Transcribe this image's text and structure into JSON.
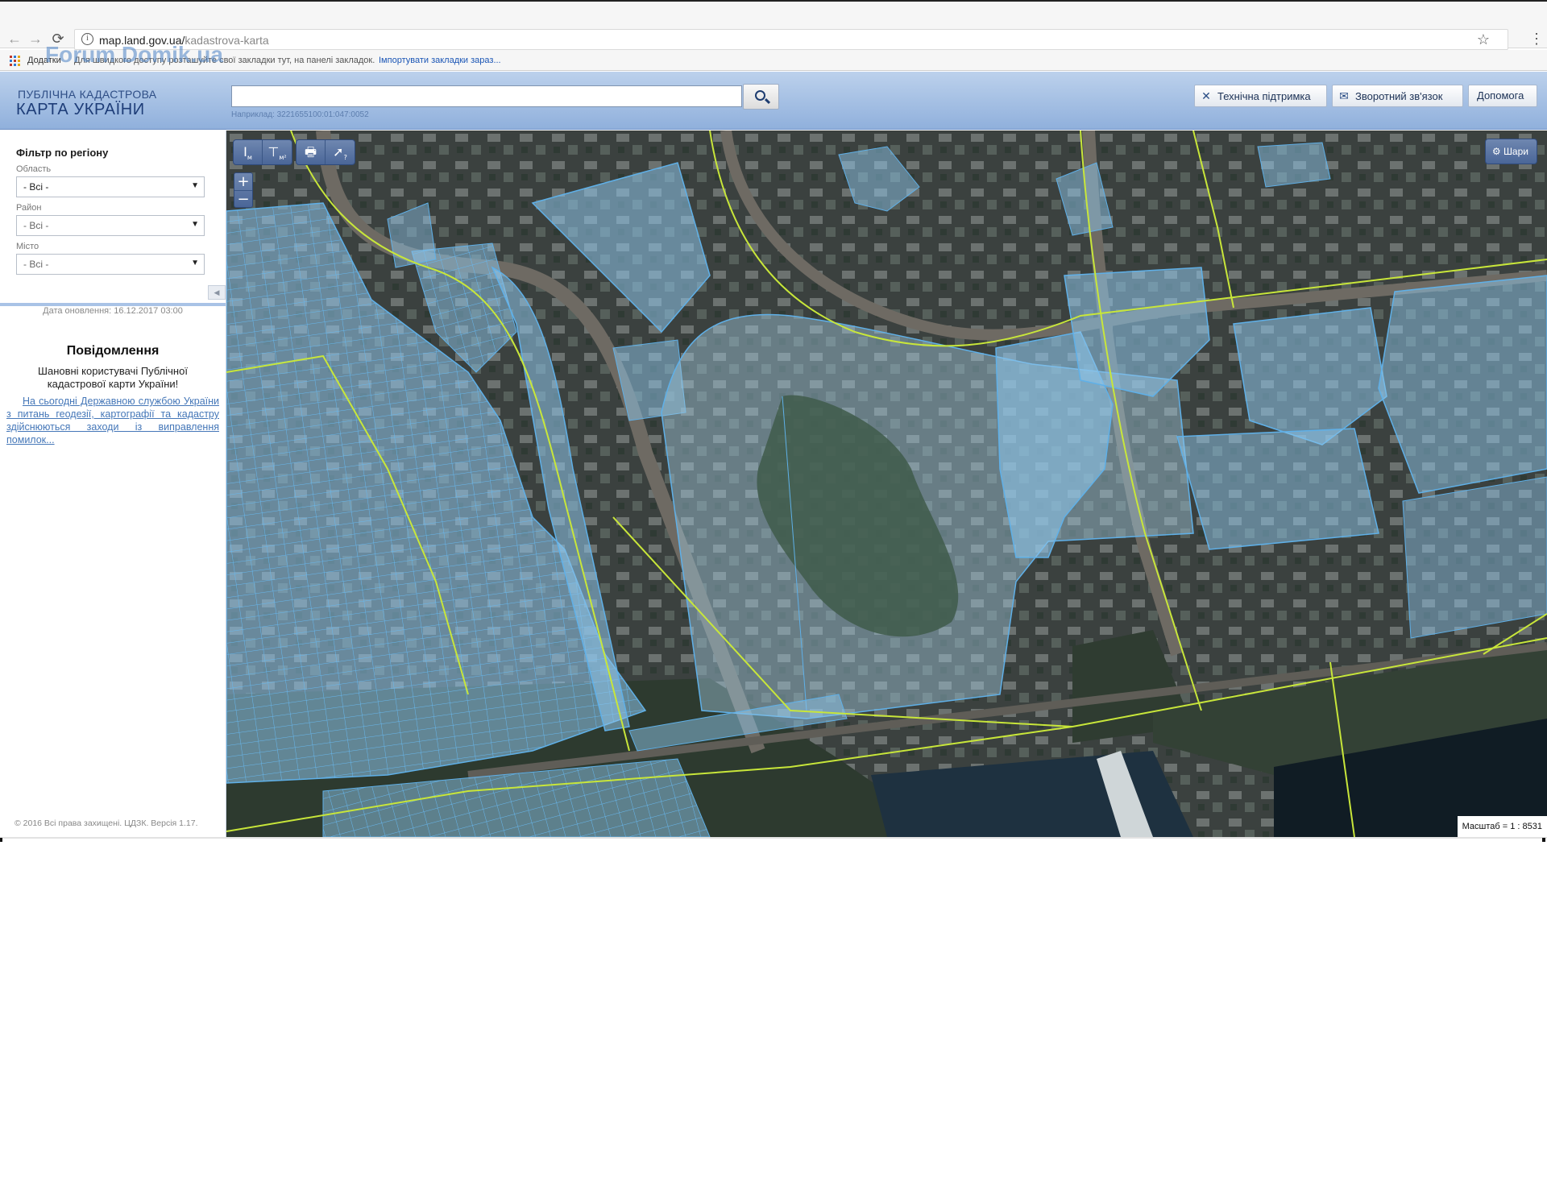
{
  "browser": {
    "url_host": "map.land.gov.ua/",
    "url_path": "kadastrova-karta",
    "bookmarks_label": "Додатки",
    "bookmarks_hint": "Для швидкого доступу розташуйте свої закладки тут, на панелі закладок.",
    "bookmarks_import": "Імпортувати закладки зараз..."
  },
  "watermark": "Forum Domik.ua",
  "header": {
    "logo_line1": "ПУБЛІЧНА КАДАСТРОВА",
    "logo_line2": "КАРТА УКРАЇНИ",
    "search_value": "",
    "search_example": "Наприклад: 3221655100:01:047:0052",
    "buttons": {
      "support": "Технічна підтримка",
      "feedback": "Зворотний зв'язок",
      "help": "Допомога"
    }
  },
  "sidebar": {
    "filter_title": "Фільтр по регіону",
    "fields": [
      {
        "label": "Область",
        "value": "- Всі -"
      },
      {
        "label": "Район",
        "value": "- Всі -"
      },
      {
        "label": "Місто",
        "value": "- Всі -"
      }
    ],
    "update_date": "Дата оновлення: 16.12.2017 03:00",
    "message_title": "Повідомлення",
    "message_text": "Шановні користувачі Публічної кадастрової карти України!",
    "message_link": "На сьогодні Державною службою України з питань геодезії, картографії та кадастру здійснюються заходи із виправлення помилок...",
    "copyright": "© 2016 Всі права захищені. ЦДЗК. Версія 1.17."
  },
  "map": {
    "layers_label": "Шари",
    "scale": "Масштаб = 1 : 8531",
    "tools": {
      "measure_length": "I",
      "measure_length_unit": "м",
      "measure_area": "⊤",
      "measure_area_unit": "м²",
      "print": "🖶",
      "identify": "?"
    },
    "zoom_in": "+",
    "zoom_out": "−",
    "colors": {
      "parcel_fill": "#8ec5ea",
      "parcel_stroke": "#5fb0e8",
      "boundary": "#c8e63a"
    }
  }
}
